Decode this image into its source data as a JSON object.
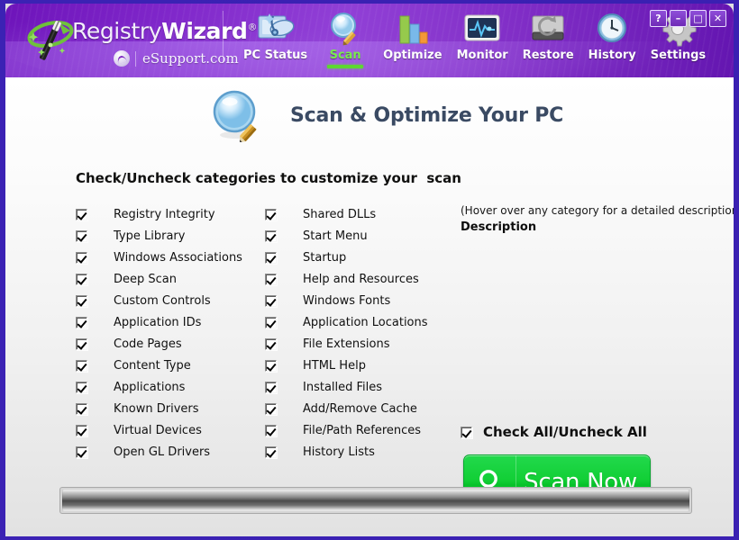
{
  "window": {
    "controls": [
      {
        "name": "help-button",
        "glyph": "?"
      },
      {
        "name": "minimize-button",
        "glyph": "–"
      },
      {
        "name": "maximize-button",
        "glyph": "□"
      },
      {
        "name": "close-button",
        "glyph": "✕"
      }
    ]
  },
  "brand": {
    "name_light": "Registry",
    "name_bold": "Wizard",
    "registered_mark": "®",
    "sub_text": "eSupport.com",
    "logo_icon": "magic-wand-icon",
    "sub_icon": "esupport-swirl-icon"
  },
  "nav": {
    "items": [
      {
        "label": "PC Status",
        "icon": "pc-status-icon",
        "active": false
      },
      {
        "label": "Scan",
        "icon": "magnifier-icon",
        "active": true
      },
      {
        "label": "Optimize",
        "icon": "bar-chart-icon",
        "active": false
      },
      {
        "label": "Monitor",
        "icon": "monitor-icon",
        "active": false
      },
      {
        "label": "Restore",
        "icon": "hard-drive-icon",
        "active": false
      },
      {
        "label": "History",
        "icon": "clock-icon",
        "active": false
      },
      {
        "label": "Settings",
        "icon": "gear-icon",
        "active": false
      }
    ],
    "active_color": "#6ee83f"
  },
  "page": {
    "title": "Scan & Optimize Your PC",
    "title_icon": "magnifier-pencil-icon",
    "instructions": "Check/Uncheck categories to customize your  scan"
  },
  "categories": {
    "column1": [
      {
        "label": "Registry Integrity",
        "checked": true
      },
      {
        "label": "Type Library",
        "checked": true
      },
      {
        "label": "Windows Associations",
        "checked": true
      },
      {
        "label": "Deep Scan",
        "checked": true
      },
      {
        "label": "Custom Controls",
        "checked": true
      },
      {
        "label": "Application IDs",
        "checked": true
      },
      {
        "label": "Code Pages",
        "checked": true
      },
      {
        "label": "Content Type",
        "checked": true
      },
      {
        "label": "Applications",
        "checked": true
      },
      {
        "label": "Known Drivers",
        "checked": true
      },
      {
        "label": "Virtual Devices",
        "checked": true
      },
      {
        "label": "Open GL Drivers",
        "checked": true
      }
    ],
    "column2": [
      {
        "label": "Shared DLLs",
        "checked": true
      },
      {
        "label": "Start Menu",
        "checked": true
      },
      {
        "label": "Startup",
        "checked": true
      },
      {
        "label": "Help and Resources",
        "checked": true
      },
      {
        "label": "Windows Fonts",
        "checked": true
      },
      {
        "label": "Application Locations",
        "checked": true
      },
      {
        "label": "File Extensions",
        "checked": true
      },
      {
        "label": "HTML Help",
        "checked": true
      },
      {
        "label": "Installed Files",
        "checked": true
      },
      {
        "label": "Add/Remove Cache",
        "checked": true
      },
      {
        "label": "File/Path References",
        "checked": true
      },
      {
        "label": "History Lists",
        "checked": true
      }
    ]
  },
  "right_panel": {
    "hover_hint": "(Hover over any category for a detailed description)",
    "description_label": "Description",
    "description_value": "",
    "check_all_label": "Check All/Uncheck All",
    "check_all_checked": true,
    "scan_button_label": "Scan Now",
    "scan_button_icon": "magnifier-icon",
    "scan_button_color": "#12cf36"
  },
  "progress": {
    "value": 0,
    "label": ""
  },
  "colors": {
    "header_purple": "#7b1fc8",
    "frame_blue": "#3a20b2",
    "body_gray": "#e2e2e2",
    "accent_green": "#4fd420"
  }
}
